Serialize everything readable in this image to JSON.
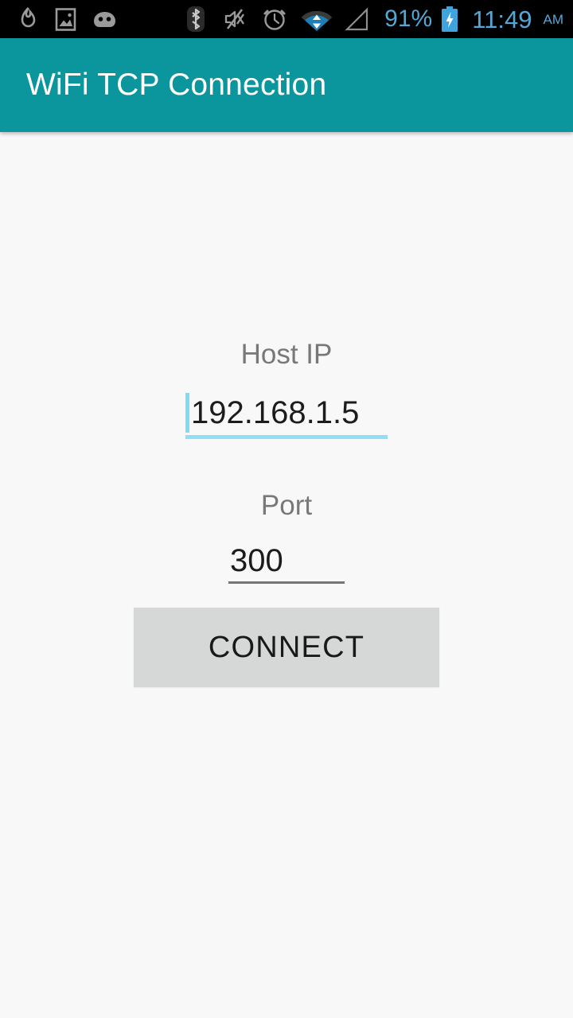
{
  "status_bar": {
    "background": "#000000",
    "accent_text_color": "#53a8d8",
    "notification_icons": [
      {
        "name": "flame-icon",
        "label": "flame"
      },
      {
        "name": "photo-icon",
        "label": "photo"
      },
      {
        "name": "android-head-icon",
        "label": "android"
      }
    ],
    "system_icons": [
      {
        "name": "bluetooth-icon",
        "label": "bluetooth"
      },
      {
        "name": "mute-icon",
        "label": "sound muted"
      },
      {
        "name": "alarm-clock-icon",
        "label": "alarm set"
      },
      {
        "name": "wifi-icon",
        "label": "wifi connected"
      },
      {
        "name": "cell-signal-icon",
        "label": "no signal"
      }
    ],
    "battery_percent": "91%",
    "battery_icon": "battery-charging-icon",
    "time": "11:49",
    "meridiem": "AM"
  },
  "app_bar": {
    "title": "WiFi TCP Connection",
    "background": "#0b969e",
    "title_color": "#ffffff"
  },
  "form": {
    "host": {
      "label": "Host IP",
      "value": "192.168.1.5",
      "placeholder": "Host IP",
      "focused": true,
      "underline_color": "#8fdff7",
      "caret_color": "#7fdcf5"
    },
    "port": {
      "label": "Port",
      "value": "300",
      "placeholder": "Port",
      "focused": false,
      "underline_color": "#757575"
    },
    "connect_button": {
      "label": "CONNECT",
      "background": "#d6d7d7",
      "text_color": "#191919"
    }
  },
  "page": {
    "background": "#f8f8f8"
  }
}
